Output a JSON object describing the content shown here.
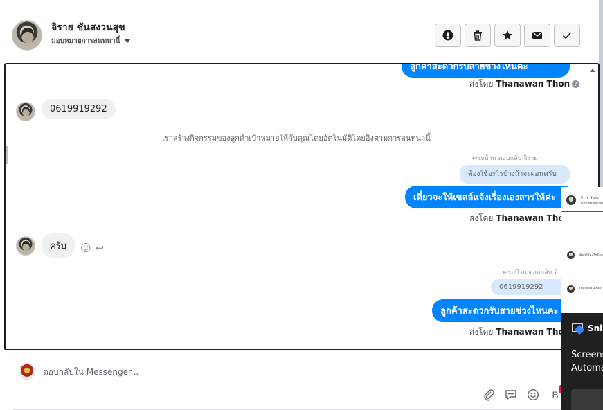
{
  "header": {
    "contact_name": "จิราย ชันสงวนสุข",
    "assign_label": "มอบหมายการสนทนานี้",
    "actions": [
      {
        "icon": "alert-icon"
      },
      {
        "icon": "trash-icon"
      },
      {
        "icon": "star-icon"
      },
      {
        "icon": "mail-icon"
      },
      {
        "icon": "check-icon"
      }
    ]
  },
  "conversation": {
    "clipped_top_text": "ลูกค้าสะดวกรับสายช่วงไหนคะ",
    "sent_by_prefix": "ส่งโดย",
    "sender_name": "Thanawan Thon",
    "customer_phone": "0619919292",
    "system_note": "เราสร้างกิจกรรมของลูกค้าเป้าหมายให้กับคุณโดยอัตโนมัติโดยอิงตามการสนทนานี้",
    "reply1_label": "รถบ้าน ตอบกลับ จิราย",
    "reply1_quote": "ต้องใช้อะไรบ้างถ้าจะผ่อนครับ",
    "reply1_message": "เดี๋ยวจะให้เซลล์แจ้งเรื่องเองสารให้ค่ะ",
    "customer_reply": "ครับ",
    "reply2_label": "รถบ้าน ตอบกลับ จิ",
    "reply2_quote": "0619919292",
    "reply2_message": "ลูกค้าสะดวกรับสายช่วงไหนคะ"
  },
  "composer": {
    "placeholder": "ตอบกลับใน Messenger..."
  },
  "overlay": {
    "mini_name": "จิราย ชันสงว",
    "mini_sub": "มอบหมายการสนท",
    "mini_quote": "ต้องใช้อะไรบ้าง",
    "mini_phone": "0619919292",
    "snip_title": "Snip",
    "line1": "Screens",
    "line2": "Automa"
  },
  "colors": {
    "accent": "#0084ff",
    "quote_bg": "#d8e9fd",
    "incoming_bg": "#f1f0f0"
  }
}
